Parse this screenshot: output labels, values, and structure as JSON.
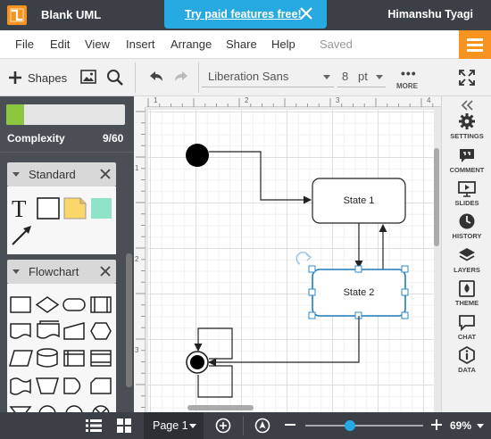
{
  "app": {
    "title": "Blank UML",
    "logo": "lucidchart-logo"
  },
  "promo": {
    "text": "Try paid features free!",
    "close_icon": "close-icon"
  },
  "user": {
    "name": "Himanshu Tyagi"
  },
  "menu": {
    "items": [
      "File",
      "Edit",
      "View",
      "Insert",
      "Arrange",
      "Share",
      "Help"
    ],
    "status": "Saved"
  },
  "toolbar": {
    "shapes_label": "Shapes",
    "font": "Liberation Sans",
    "font_size": "8",
    "font_unit": "pt",
    "more_label": "MORE"
  },
  "complexity": {
    "label": "Complexity",
    "count": "9/60",
    "value": 9,
    "max": 60
  },
  "libraries": [
    {
      "title": "Standard"
    },
    {
      "title": "Flowchart"
    }
  ],
  "ruler": {
    "top": [
      "1",
      "2",
      "3",
      "4"
    ],
    "left": [
      "1",
      "2",
      "3"
    ]
  },
  "diagram": {
    "states": [
      {
        "label": "State 1"
      },
      {
        "label": "State 2"
      }
    ]
  },
  "right_panel": {
    "items": [
      {
        "label": "SETTINGS",
        "icon": "gear-icon"
      },
      {
        "label": "COMMENT",
        "icon": "comment-icon"
      },
      {
        "label": "SLIDES",
        "icon": "slides-icon"
      },
      {
        "label": "HISTORY",
        "icon": "clock-icon"
      },
      {
        "label": "LAYERS",
        "icon": "layers-icon"
      },
      {
        "label": "THEME",
        "icon": "theme-icon"
      },
      {
        "label": "CHAT",
        "icon": "chat-icon"
      },
      {
        "label": "DATA",
        "icon": "data-icon"
      }
    ]
  },
  "bottom": {
    "page_label": "Page 1",
    "zoom": "69%",
    "zoom_level_percent": 69
  },
  "colors": {
    "accent": "#f7931e",
    "promo": "#27a9e1",
    "dark": "#3a4046",
    "complexity": "#8dc63f"
  }
}
